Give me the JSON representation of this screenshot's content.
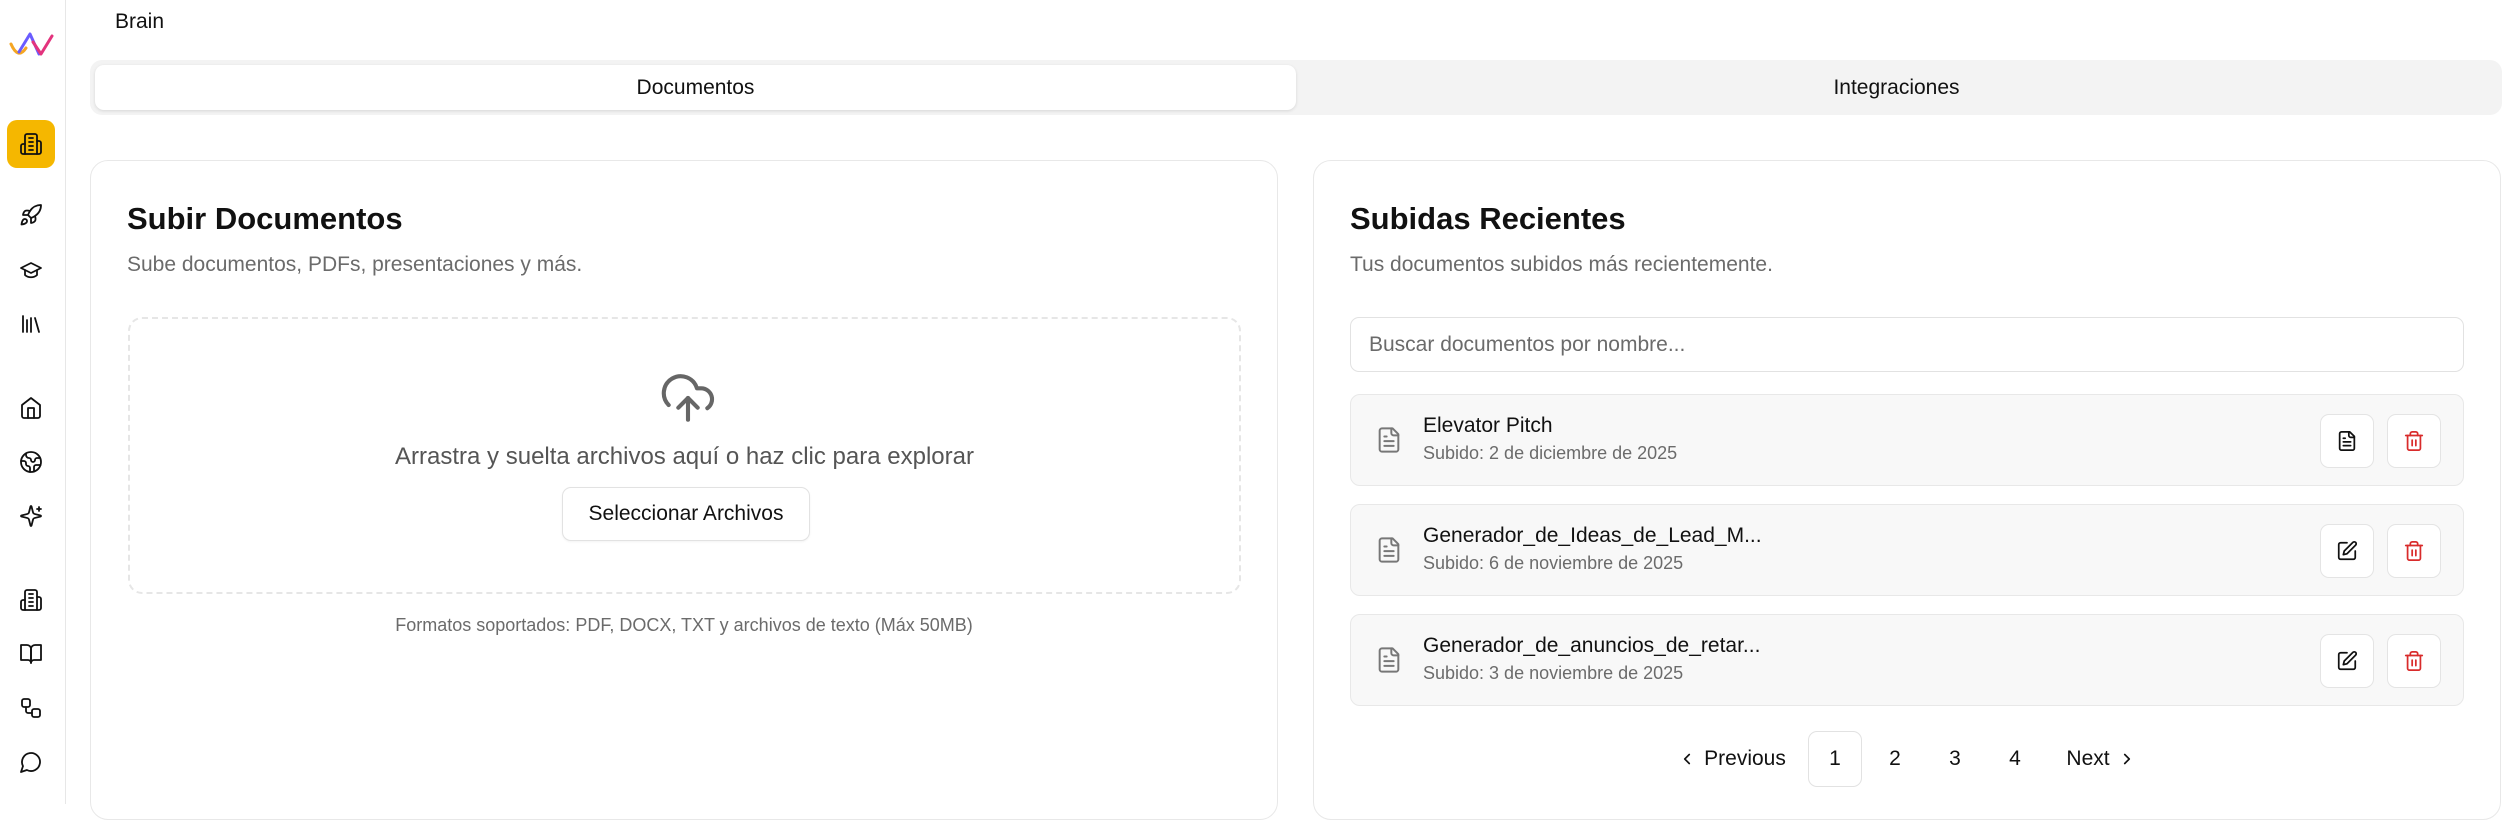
{
  "header": {
    "title": "Brain"
  },
  "tabs": [
    {
      "label": "Documentos",
      "active": true
    },
    {
      "label": "Integraciones",
      "active": false
    }
  ],
  "upload": {
    "title": "Subir Documentos",
    "subtitle": "Sube documentos, PDFs, presentaciones y más.",
    "drop_text": "Arrastra y suelta archivos aquí o haz clic para explorar",
    "select_label": "Seleccionar Archivos",
    "formats": "Formatos soportados: PDF, DOCX, TXT y archivos de texto (Máx 50MB)"
  },
  "recent": {
    "title": "Subidas Recientes",
    "subtitle": "Tus documentos subidos más recientemente.",
    "search_placeholder": "Buscar documentos por nombre...",
    "documents": [
      {
        "name": "Elevator Pitch",
        "date": "Subido: 2 de diciembre de 2025",
        "primary_action": "view-document"
      },
      {
        "name": "Generador_de_Ideas_de_Lead_M...",
        "date": "Subido: 6 de noviembre de 2025",
        "primary_action": "edit"
      },
      {
        "name": "Generador_de_anuncios_de_retar...",
        "date": "Subido: 3 de noviembre de 2025",
        "primary_action": "edit"
      }
    ]
  },
  "pagination": {
    "previous": "Previous",
    "next": "Next",
    "pages": [
      "1",
      "2",
      "3",
      "4"
    ],
    "current": "1"
  },
  "sidebar": {
    "items": [
      {
        "icon": "building-icon",
        "active": true
      },
      {
        "icon": "rocket-icon",
        "active": false
      },
      {
        "icon": "graduation-cap-icon",
        "active": false
      },
      {
        "icon": "library-icon",
        "active": false
      },
      {
        "icon": "home-icon",
        "active": false
      },
      {
        "icon": "globe-icon",
        "active": false
      },
      {
        "icon": "sparkles-icon",
        "active": false
      },
      {
        "icon": "building-icon",
        "active": false
      },
      {
        "icon": "book-open-icon",
        "active": false
      },
      {
        "icon": "workflow-icon",
        "active": false
      },
      {
        "icon": "message-circle-icon",
        "active": false
      }
    ]
  },
  "colors": {
    "accent": "#f5b700",
    "danger": "#d92b2b",
    "muted_text": "#6b6b6b",
    "border": "#e8e8e8"
  }
}
